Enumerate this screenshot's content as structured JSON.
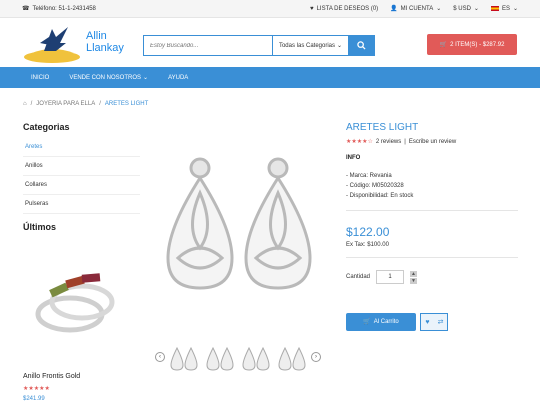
{
  "topbar": {
    "phone": "Teléfono: 51-1-2431458",
    "wishlist": "LISTA DE DESEOS (0)",
    "account": "MI CUENTA",
    "currency": "$ USD",
    "language": "ES"
  },
  "brand": {
    "line1": "Allin",
    "line2": "Llankay"
  },
  "search": {
    "placeholder": "Estoy Buscando...",
    "category": "Todas las Categorias"
  },
  "cart": {
    "label": "2 ITEM(S) - $287.92"
  },
  "nav": {
    "items": [
      "INICIO",
      "VENDE CON NOSOTROS",
      "AYUDA"
    ]
  },
  "breadcrumb": {
    "level1": "JOYERIA PARA ELLA",
    "level2": "ARETES LIGHT"
  },
  "sidebar": {
    "categories_title": "Categorias",
    "categories": [
      "Aretes",
      "Anillos",
      "Collares",
      "Pulseras"
    ],
    "latest_title": "Últimos",
    "latest_product": {
      "name": "Anillo Frontis Gold",
      "stars": "★★★★★",
      "price": "$241.99"
    }
  },
  "product": {
    "title": "ARETES LIGHT",
    "stars": "★★★★☆",
    "reviews": "2 reviews",
    "write_review": "Escribe un review",
    "info_title": "INFO",
    "brand": "- Marca: Revania",
    "code": "- Código: M05020328",
    "availability": "- Disponibilidad: En stock",
    "price": "$122.00",
    "extax": "Ex Tax: $100.00",
    "qty_label": "Cantidad",
    "qty_value": "1",
    "add_to_cart": "Al Carrito"
  },
  "colors": {
    "accent": "#3a8fd6",
    "cart": "#e15a58"
  }
}
